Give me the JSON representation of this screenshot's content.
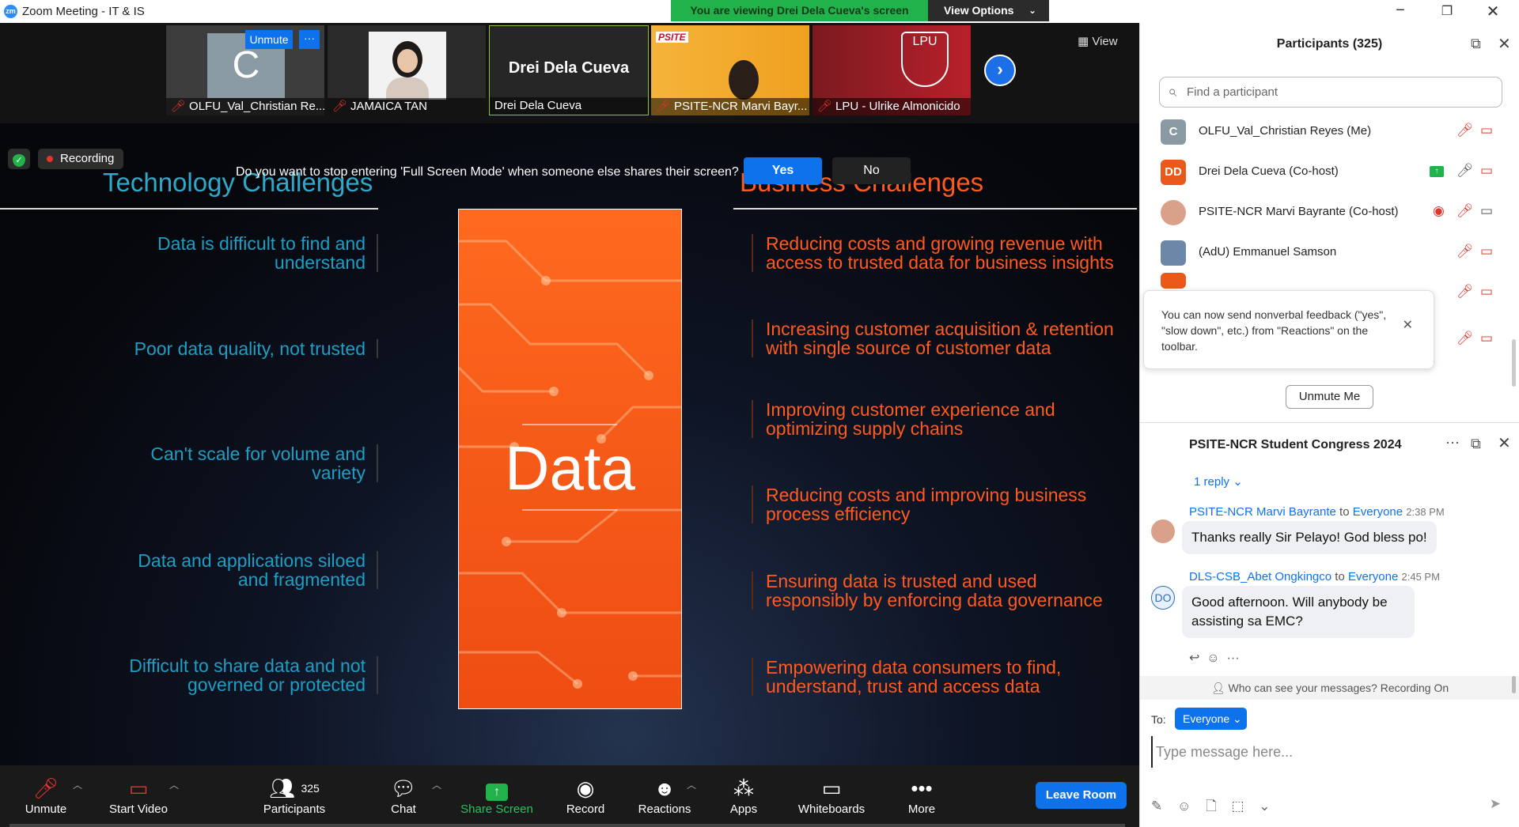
{
  "window": {
    "title": "Zoom Meeting - IT & IS",
    "logo": "zm"
  },
  "banner": {
    "viewing": "You are viewing Drei Dela Cueva's screen",
    "view_options": "View Options"
  },
  "thumbnails": [
    {
      "name": "OLFU_Val_Christian Re...",
      "initial": "C",
      "unmute": "Unmute",
      "more": "···"
    },
    {
      "name": "JAMAICA TAN"
    },
    {
      "name": "Drei Dela Cueva",
      "display": "Drei Dela Cueva"
    },
    {
      "name": "PSITE-NCR Marvi Bayr...",
      "logo_text": "PSITE"
    },
    {
      "name": "LPU - Ulrike Almonicido",
      "logo_text": "LPU"
    }
  ],
  "view_label": "View",
  "security": {
    "recording": "Recording"
  },
  "fullscreen_prompt": {
    "question": "Do you want to stop entering 'Full Screen Mode' when someone else shares their screen?",
    "yes": "Yes",
    "no": "No"
  },
  "slide": {
    "left_heading": "Technology Challenges",
    "right_heading": "Business Challenges",
    "center_word": "Data",
    "tech_items": [
      "Data is difficult to find and understand",
      "Poor data quality, not trusted",
      "Can't scale for volume and variety",
      "Data and applications siloed and fragmented",
      "Difficult to share data and not governed or protected"
    ],
    "business_items": [
      "Reducing costs and growing revenue with access to trusted data for business insights",
      "Increasing customer acquisition & retention with single source of customer data",
      "Improving customer experience and optimizing supply chains",
      "Reducing costs and improving business process efficiency",
      "Ensuring data is trusted and used responsibly by enforcing data governance",
      "Empowering data consumers to find, understand, trust and access data"
    ]
  },
  "toolbar": {
    "unmute": "Unmute",
    "start_video": "Start Video",
    "participants": "Participants",
    "participants_count": "325",
    "chat": "Chat",
    "share_screen": "Share Screen",
    "record": "Record",
    "reactions": "Reactions",
    "apps": "Apps",
    "whiteboards": "Whiteboards",
    "more": "More",
    "leave": "Leave Room"
  },
  "participants_panel": {
    "title": "Participants (325)",
    "search_placeholder": "Find a participant",
    "list": [
      {
        "name": "OLFU_Val_Christian Reyes (Me)",
        "initials": "C",
        "color": "#8a9aa3"
      },
      {
        "name": "Drei Dela Cueva (Co-host)",
        "initials": "DD",
        "color": "#e8591a"
      },
      {
        "name": "PSITE-NCR Marvi Bayrante (Co-host)",
        "initials": "",
        "color": "#d9a08a"
      },
      {
        "name": "(AdU) Emmanuel Samson",
        "initials": "",
        "color": "#6d87a8"
      }
    ],
    "tooltip": "You can now send nonverbal feedback (\"yes\", \"slow down\", etc.) from \"Reactions\" on the toolbar.",
    "unmute_me": "Unmute Me"
  },
  "chat_panel": {
    "title": "PSITE-NCR Student Congress 2024",
    "reply": "1 reply",
    "messages": [
      {
        "sender": "PSITE-NCR Marvi Bayrante",
        "to": "to",
        "recipient": "Everyone",
        "time": "2:38 PM",
        "text": "Thanks really Sir Pelayo! God bless po!"
      },
      {
        "sender": "DLS-CSB_Abet Ongkingco",
        "to": "to",
        "recipient": "Everyone",
        "time": "2:45 PM",
        "text": "Good afternoon. Will anybody be assisting sa EMC?",
        "initials": "DO"
      }
    ],
    "visibility": "Who can see your messages? Recording On",
    "to_label": "To:",
    "to_value": "Everyone",
    "input_placeholder": "Type message here..."
  }
}
